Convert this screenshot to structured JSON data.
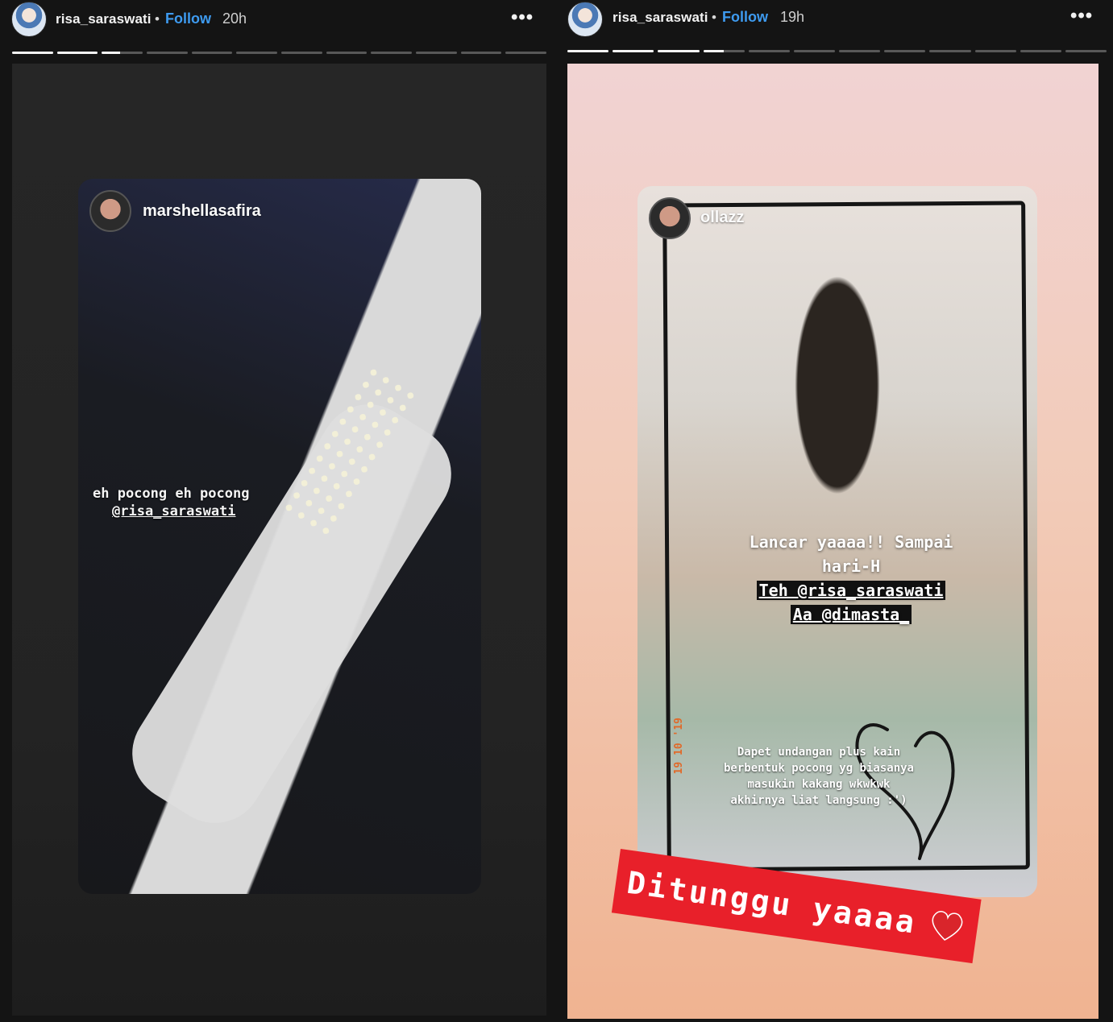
{
  "stories": [
    {
      "header": {
        "username": "risa_saraswati",
        "separator": "•",
        "follow_label": "Follow",
        "time": "20h",
        "more_label": "•••"
      },
      "progress": {
        "segments": 12,
        "current_index": 2,
        "current_fill": 0.45
      },
      "shared_post": {
        "username": "marshellasafira",
        "caption_line1": "eh pocong eh pocong",
        "caption_mention": "@risa_saraswati"
      }
    },
    {
      "header": {
        "username": "risa_saraswati",
        "separator": "•",
        "follow_label": "Follow",
        "time": "19h",
        "more_label": "•••"
      },
      "progress": {
        "segments": 12,
        "current_index": 3,
        "current_fill": 0.5
      },
      "shared_post": {
        "username": "ollazz",
        "caption_line1": "Lancar yaaaa!! Sampai",
        "caption_line2": "hari-H",
        "caption_line3": "Teh @risa_saraswati",
        "caption_line4": "Aa @dimasta_",
        "note_line1": "Dapet undangan plus kain",
        "note_line2": "berbentuk pocong yg biasanya",
        "note_line3": "masukin kakang wkwkwk",
        "note_line4": "akhirnya liat langsung :')",
        "stamp": "19 10 '19"
      },
      "sticker": {
        "text": "Ditunggu yaaaa",
        "icon": "heart-icon",
        "color": "#e8202a"
      }
    }
  ],
  "colors": {
    "follow": "#3e9bf0",
    "progress_active": "#f5f5f5",
    "progress_inactive": "#585858"
  }
}
